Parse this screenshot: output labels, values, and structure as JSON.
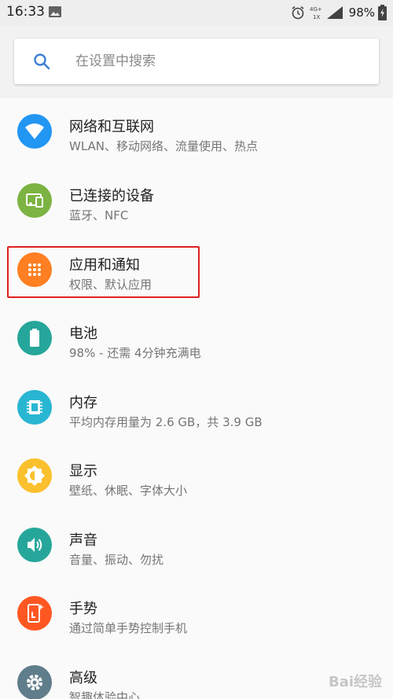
{
  "status_bar": {
    "time": "16:33",
    "net_top": "4G+",
    "net_bottom": "1X",
    "battery_percent": "98%"
  },
  "search": {
    "placeholder": "在设置中搜索"
  },
  "colors": {
    "wifi": "#2196f3",
    "devices": "#7cb342",
    "apps": "#ff7f22",
    "battery": "#26a69a",
    "storage": "#29b6d2",
    "display": "#fbc02d",
    "sound": "#26a69a",
    "gestures": "#ff5722",
    "advanced": "#607d8b",
    "highlight": "#e02020"
  },
  "settings": [
    {
      "title": "网络和互联网",
      "subtitle": "WLAN、移动网络、流量使用、热点",
      "icon": "wifi-icon"
    },
    {
      "title": "已连接的设备",
      "subtitle": "蓝牙、NFC",
      "icon": "devices-icon"
    },
    {
      "title": "应用和通知",
      "subtitle": "权限、默认应用",
      "icon": "apps-icon"
    },
    {
      "title": "电池",
      "subtitle": "98% - 还需 4分钟充满电",
      "icon": "battery-icon"
    },
    {
      "title": "内存",
      "subtitle": "平均内存用量为 2.6 GB，共 3.9 GB",
      "icon": "memory-icon"
    },
    {
      "title": "显示",
      "subtitle": "壁纸、休眠、字体大小",
      "icon": "display-icon"
    },
    {
      "title": "声音",
      "subtitle": "音量、振动、勿扰",
      "icon": "sound-icon"
    },
    {
      "title": "手势",
      "subtitle": "通过简单手势控制手机",
      "icon": "gestures-icon"
    },
    {
      "title": "高级",
      "subtitle": "智趣体验中心",
      "icon": "advanced-icon"
    }
  ],
  "watermark": "Bai经验"
}
